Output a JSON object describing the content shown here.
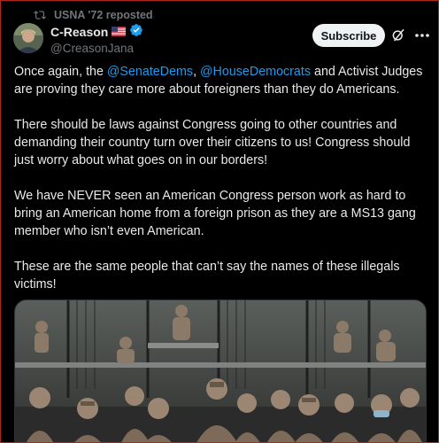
{
  "repost": {
    "text": "USNA '72 reposted"
  },
  "author": {
    "name": "C-Reason",
    "flag": "US flag",
    "verified_icon": "verified-badge-icon",
    "handle": "@CreasonJana"
  },
  "actions": {
    "subscribe_label": "Subscribe",
    "grok_icon": "grok-icon",
    "more_icon": "more-options-icon"
  },
  "tweet": {
    "p1": {
      "t1": "Once again, the ",
      "m1": "@SenateDems",
      "t2": ", ",
      "m2": "@HouseDemocrats",
      "t3": " and Activist Judges are proving they care more about foreigners than they do Americans."
    },
    "p2": "There should be laws against Congress going to other countries and demanding their country turn over their citizens to us! Congress should just worry about what goes on in our borders!",
    "p3": "We have NEVER seen an American Congress person work as hard to bring an American home from a foreign prison as they are a MS13 gang member who isn’t even American.",
    "p4": "These are the same people that can’t say the names of these illegals victims!"
  },
  "media": {
    "description_icon": "prison-photo"
  },
  "colors": {
    "background": "#000000",
    "text": "#e7e9ea",
    "muted": "#71767b",
    "link": "#1d9bf0",
    "verified": "#1d9bf0",
    "subscribe_bg": "#eff3f4",
    "frame_border": "#b3261e"
  }
}
